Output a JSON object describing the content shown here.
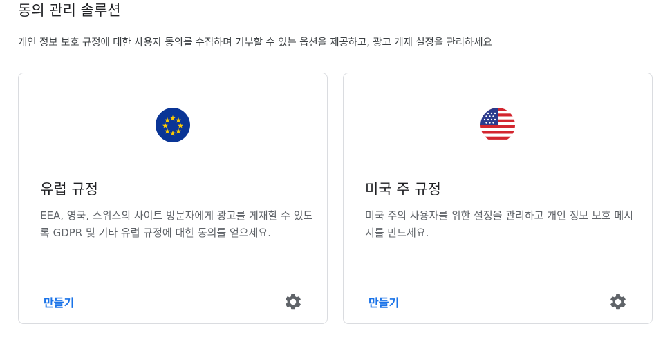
{
  "header": {
    "title": "동의 관리 솔루션",
    "description": "개인 정보 보호 규정에 대한 사용자 동의를 수집하며 거부할 수 있는 옵션을 제공하고, 광고 게재 설정을 관리하세요"
  },
  "cards": [
    {
      "flag_icon": "eu-flag-icon",
      "title": "유럽 규정",
      "description": "EEA, 영국, 스위스의 사이트 방문자에게 광고를 게재할 수 있도록 GDPR 및 기타 유럽 규정에 대한 동의를 얻으세요.",
      "action_label": "만들기",
      "settings_icon": "gear-icon"
    },
    {
      "flag_icon": "us-flag-icon",
      "title": "미국 주 규정",
      "description": "미국 주의 사용자를 위한 설정을 관리하고 개인 정보 보호 메시지를 만드세요.",
      "action_label": "만들기",
      "settings_icon": "gear-icon"
    }
  ],
  "colors": {
    "link": "#1a73e8",
    "eu_blue": "#0a3596",
    "eu_star": "#ffcc00",
    "us_red": "#d3262f",
    "us_blue": "#2b3a8c"
  }
}
